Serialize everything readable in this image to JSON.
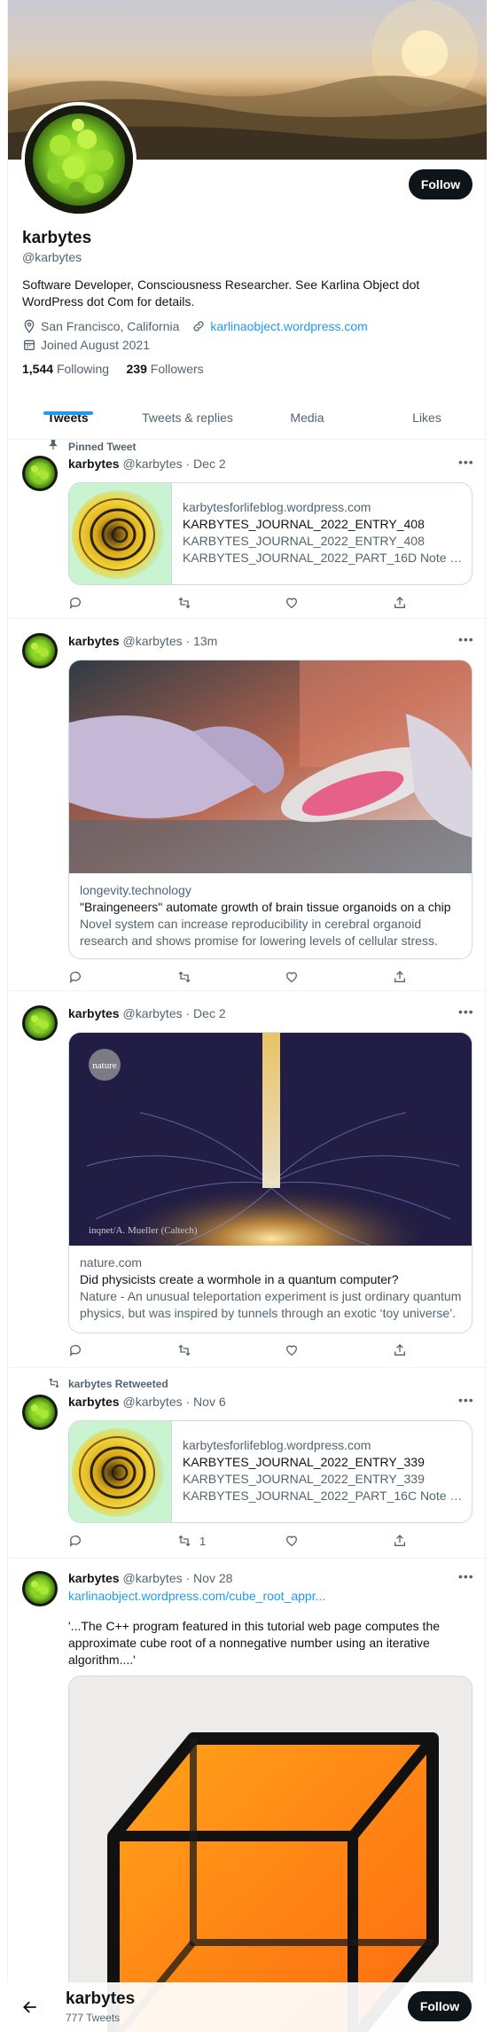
{
  "profile": {
    "name": "karbytes",
    "handle": "@karbytes",
    "follow_label": "Follow",
    "bio": "Software Developer, Consciousness Researcher. See Karlina Object dot WordPress dot Com for details.",
    "location": "San Francisco, California",
    "website": "karlinaobject.wordpress.com",
    "joined": "Joined August 2021",
    "following_count": "1,544",
    "following_label": "Following",
    "followers_count": "239",
    "followers_label": "Followers"
  },
  "tabs": [
    "Tweets",
    "Tweets & replies",
    "Media",
    "Likes"
  ],
  "tweets": [
    {
      "context": "Pinned Tweet",
      "name": "karbytes",
      "handle": "@karbytes",
      "time": "· Dec 2",
      "card": {
        "domain": "karbytesforlifeblog.wordpress.com",
        "title": "KARBYTES_JOURNAL_2022_ENTRY_408",
        "desc1": "KARBYTES_JOURNAL_2022_ENTRY_408",
        "desc2": "KARBYTES_JOURNAL_2022_PART_16D Note that ..."
      },
      "retweets": "",
      "likes": ""
    },
    {
      "name": "karbytes",
      "handle": "@karbytes",
      "time": "· 13m",
      "card": {
        "domain": "longevity.technology",
        "title": "\"Braingeneers\" automate growth of brain tissue organoids on a chip",
        "desc": "Novel system can increase reproducibility in cerebral organoid research and shows promise for lowering levels of cellular stress."
      }
    },
    {
      "name": "karbytes",
      "handle": "@karbytes",
      "time": "· Dec 2",
      "card": {
        "badge": "nature",
        "credit": "inqnet/A. Mueller (Caltech)",
        "domain": "nature.com",
        "title": "Did physicists create a wormhole in a quantum computer?",
        "desc": "Nature - An unusual teleportation experiment is just ordinary quantum physics, but was inspired by tunnels through an exotic ‘toy universe’."
      }
    },
    {
      "context": "karbytes Retweeted",
      "name": "karbytes",
      "handle": "@karbytes",
      "time": "· Nov 6",
      "card": {
        "domain": "karbytesforlifeblog.wordpress.com",
        "title": "KARBYTES_JOURNAL_2022_ENTRY_339",
        "desc1": "KARBYTES_JOURNAL_2022_ENTRY_339",
        "desc2": "KARBYTES_JOURNAL_2022_PART_16C Note that ..."
      },
      "retweets": "1"
    },
    {
      "name": "karbytes",
      "handle": "@karbytes",
      "time": "· Nov 28",
      "link": "karlinaobject.wordpress.com/cube_root_appr...",
      "text": "'...The C++ program featured in this tutorial web page computes the approximate cube root of a nonnegative number using an iterative algorithm....'"
    }
  ],
  "bottom_bar": {
    "name": "karbytes",
    "tweet_count": "777 Tweets",
    "follow_label": "Follow"
  },
  "icons": [
    "location-icon",
    "link-icon",
    "calendar-icon",
    "pin-icon",
    "retweet-icon",
    "reply-icon",
    "like-icon",
    "share-icon",
    "more-icon",
    "back-arrow-icon"
  ],
  "colors": {
    "accent": "#1d9bf0",
    "text": "#0f1419",
    "secondary": "#536471",
    "border": "#cfd9de"
  }
}
